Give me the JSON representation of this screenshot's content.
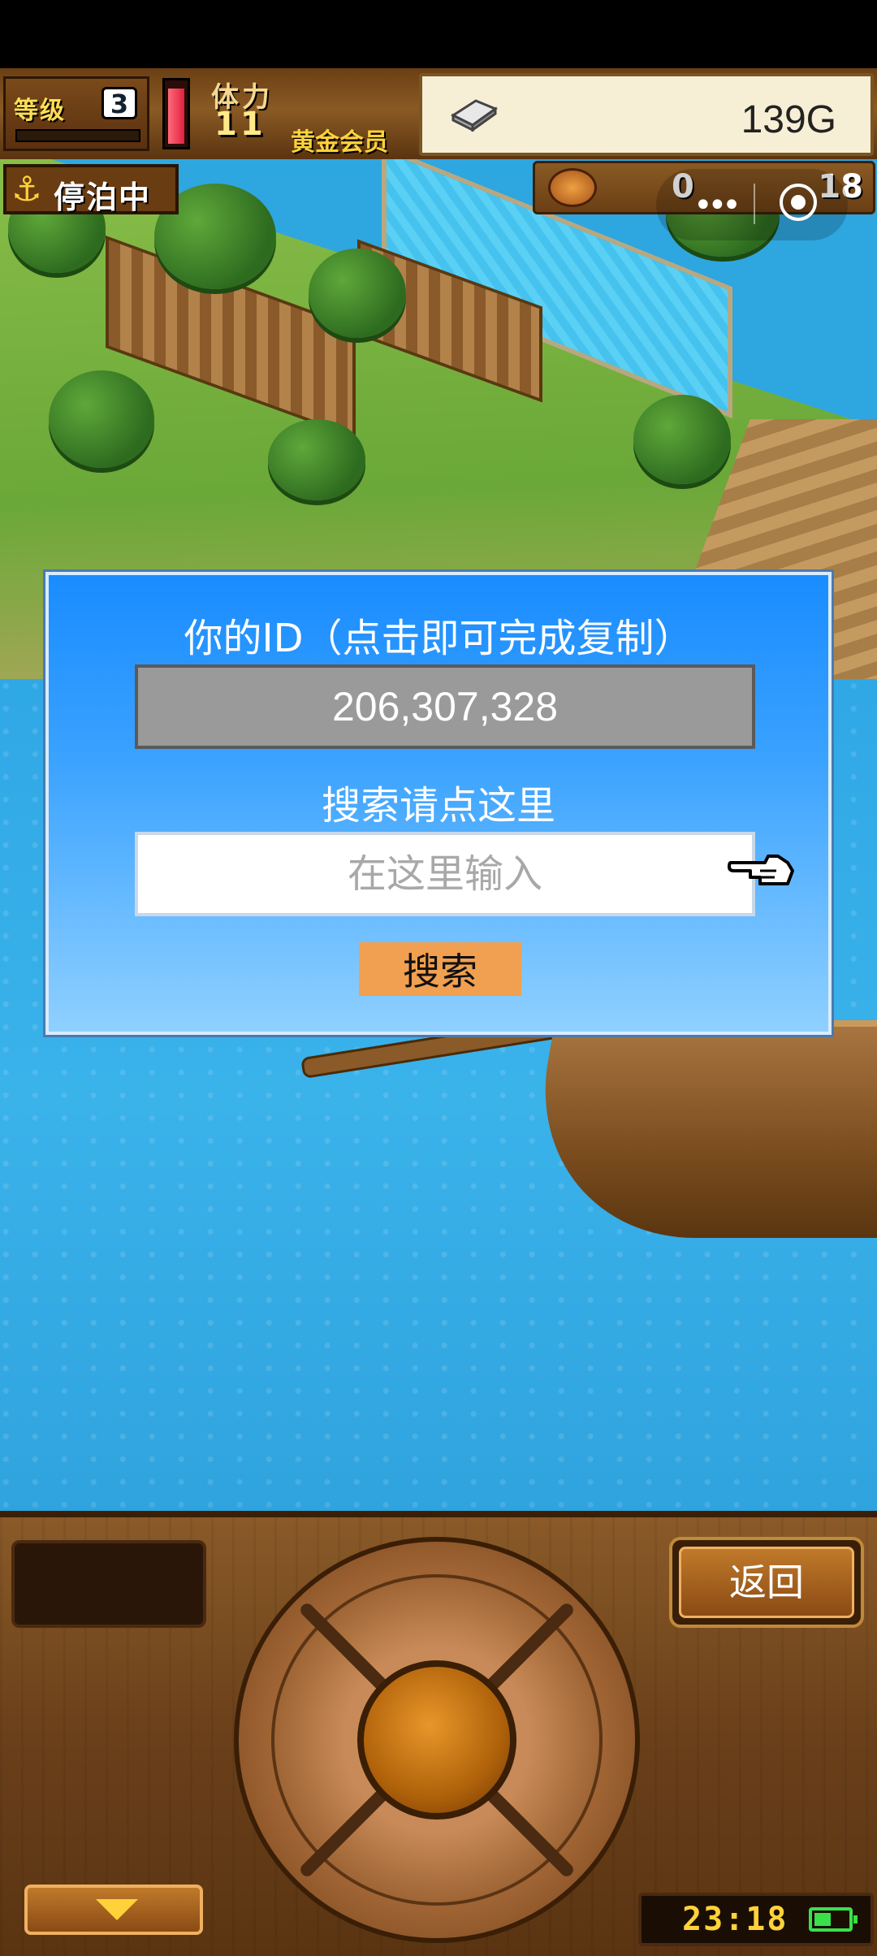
{
  "hud": {
    "level_label": "等级",
    "level_value": "3",
    "stamina_label": "体力",
    "stamina_value": "11",
    "membership": "黄金会员",
    "gold": "139G",
    "status": "停泊中",
    "resource_count_1": "0",
    "resource_count_2": "18",
    "stamina_fill": 0.95
  },
  "dialog": {
    "title": "你的ID（点击即可完成复制）",
    "user_id": "206,307,328",
    "search_hint": "搜索请点这里",
    "search_placeholder": "在这里输入",
    "search_value": "",
    "search_button": "搜索"
  },
  "controls": {
    "back_button": "返回",
    "clock": "23:18"
  },
  "colors": {
    "dialog_top": "#1a8cff",
    "dialog_bottom": "#8fd0ff",
    "id_box": "#9a9a9a",
    "search_button": "#f0a050",
    "sea": "#2fa8e6"
  }
}
